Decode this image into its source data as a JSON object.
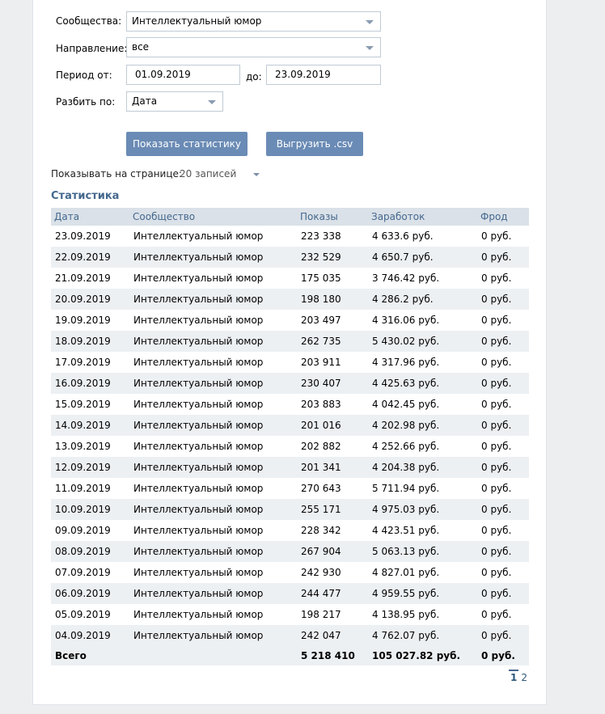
{
  "filters": {
    "community_label": "Сообщества:",
    "community_value": "Интеллектуальный юмор",
    "direction_label": "Направление:",
    "direction_value": "все",
    "period_label": "Период от:",
    "period_from": "01.09.2019",
    "period_to_label": "до:",
    "period_to": "23.09.2019",
    "split_label": "Разбить по:",
    "split_value": "Дата"
  },
  "buttons": {
    "show_stats": "Показать статистику",
    "export_csv": "Выгрузить .csv"
  },
  "per_page": {
    "label": "Показывать на странице:",
    "value": "20 записей"
  },
  "stats": {
    "title": "Статистика",
    "columns": [
      "Дата",
      "Сообщество",
      "Показы",
      "Заработок",
      "Фрод"
    ],
    "rows": [
      [
        "23.09.2019",
        "Интеллектуальный юмор",
        "223 338",
        "4 633.6 руб.",
        "0 руб."
      ],
      [
        "22.09.2019",
        "Интеллектуальный юмор",
        "232 529",
        "4 650.7 руб.",
        "0 руб."
      ],
      [
        "21.09.2019",
        "Интеллектуальный юмор",
        "175 035",
        "3 746.42 руб.",
        "0 руб."
      ],
      [
        "20.09.2019",
        "Интеллектуальный юмор",
        "198 180",
        "4 286.2 руб.",
        "0 руб."
      ],
      [
        "19.09.2019",
        "Интеллектуальный юмор",
        "203 497",
        "4 316.06 руб.",
        "0 руб."
      ],
      [
        "18.09.2019",
        "Интеллектуальный юмор",
        "262 735",
        "5 430.02 руб.",
        "0 руб."
      ],
      [
        "17.09.2019",
        "Интеллектуальный юмор",
        "203 911",
        "4 317.96 руб.",
        "0 руб."
      ],
      [
        "16.09.2019",
        "Интеллектуальный юмор",
        "230 407",
        "4 425.63 руб.",
        "0 руб."
      ],
      [
        "15.09.2019",
        "Интеллектуальный юмор",
        "203 883",
        "4 042.45 руб.",
        "0 руб."
      ],
      [
        "14.09.2019",
        "Интеллектуальный юмор",
        "201 016",
        "4 202.98 руб.",
        "0 руб."
      ],
      [
        "13.09.2019",
        "Интеллектуальный юмор",
        "202 882",
        "4 252.66 руб.",
        "0 руб."
      ],
      [
        "12.09.2019",
        "Интеллектуальный юмор",
        "201 341",
        "4 204.38 руб.",
        "0 руб."
      ],
      [
        "11.09.2019",
        "Интеллектуальный юмор",
        "270 643",
        "5 711.94 руб.",
        "0 руб."
      ],
      [
        "10.09.2019",
        "Интеллектуальный юмор",
        "255 171",
        "4 975.03 руб.",
        "0 руб."
      ],
      [
        "09.09.2019",
        "Интеллектуальный юмор",
        "228 342",
        "4 423.51 руб.",
        "0 руб."
      ],
      [
        "08.09.2019",
        "Интеллектуальный юмор",
        "267 904",
        "5 063.13 руб.",
        "0 руб."
      ],
      [
        "07.09.2019",
        "Интеллектуальный юмор",
        "242 930",
        "4 827.01 руб.",
        "0 руб."
      ],
      [
        "06.09.2019",
        "Интеллектуальный юмор",
        "244 477",
        "4 959.55 руб.",
        "0 руб."
      ],
      [
        "05.09.2019",
        "Интеллектуальный юмор",
        "198 217",
        "4 138.95 руб.",
        "0 руб."
      ],
      [
        "04.09.2019",
        "Интеллектуальный юмор",
        "242 047",
        "4 762.07 руб.",
        "0 руб."
      ]
    ],
    "total": {
      "label": "Всего",
      "impressions": "5 218 410",
      "earnings": "105 027.82 руб.",
      "fraud": "0 руб."
    }
  },
  "pager": {
    "current": "1",
    "pages": [
      "2"
    ]
  }
}
